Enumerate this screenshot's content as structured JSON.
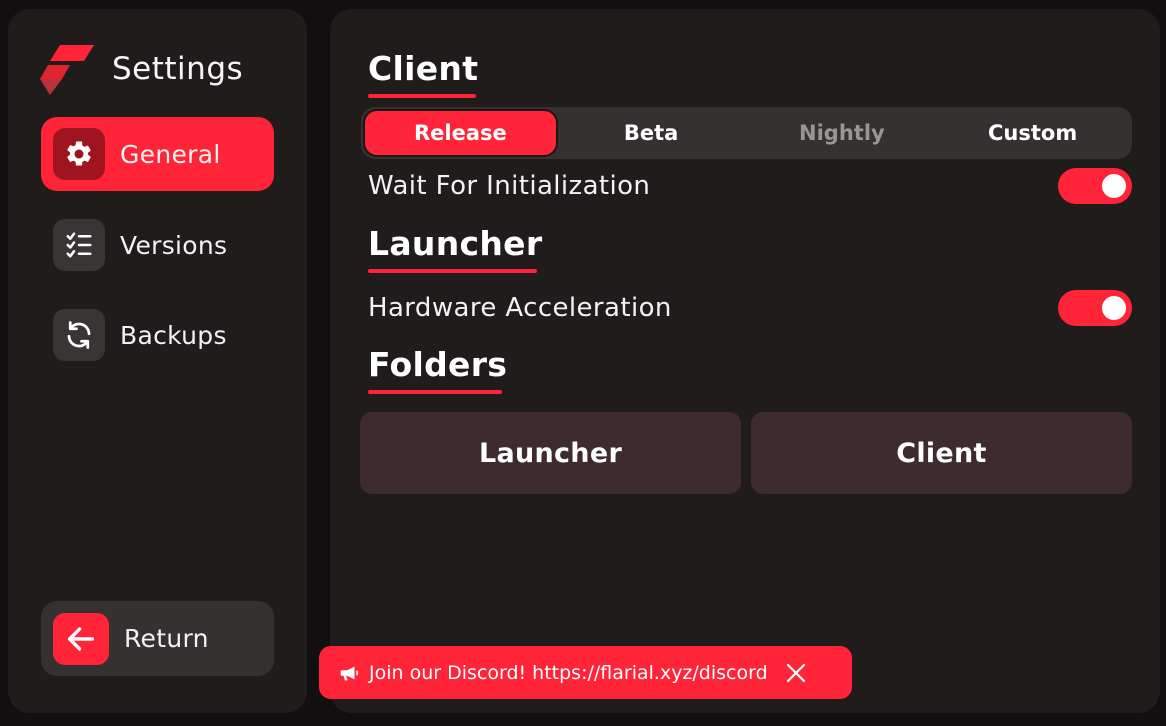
{
  "app": {
    "title": "Settings",
    "accent_color": "#ff2438",
    "icon": "flarial-logo"
  },
  "sidebar": {
    "items": [
      {
        "label": "General",
        "icon": "gear-icon",
        "active": true
      },
      {
        "label": "Versions",
        "icon": "checklist-icon",
        "active": false
      },
      {
        "label": "Backups",
        "icon": "refresh-icon",
        "active": false
      }
    ],
    "return": {
      "label": "Return",
      "icon": "arrow-left-icon"
    }
  },
  "main": {
    "client": {
      "title": "Client",
      "channels": [
        {
          "label": "Release",
          "selected": true
        },
        {
          "label": "Beta",
          "selected": false
        },
        {
          "label": "Nightly",
          "selected": false
        },
        {
          "label": "Custom",
          "selected": false
        }
      ],
      "wait_for_initialization": {
        "label": "Wait For Initialization",
        "enabled": true
      }
    },
    "launcher": {
      "title": "Launcher",
      "hardware_acceleration": {
        "label": "Hardware Acceleration",
        "enabled": true
      }
    },
    "folders": {
      "title": "Folders",
      "launcher_button": "Launcher",
      "client_button": "Client"
    }
  },
  "toast": {
    "icon": "megaphone-icon",
    "text": "Join our Discord! https://flarial.xyz/discord",
    "close_icon": "close-icon"
  }
}
